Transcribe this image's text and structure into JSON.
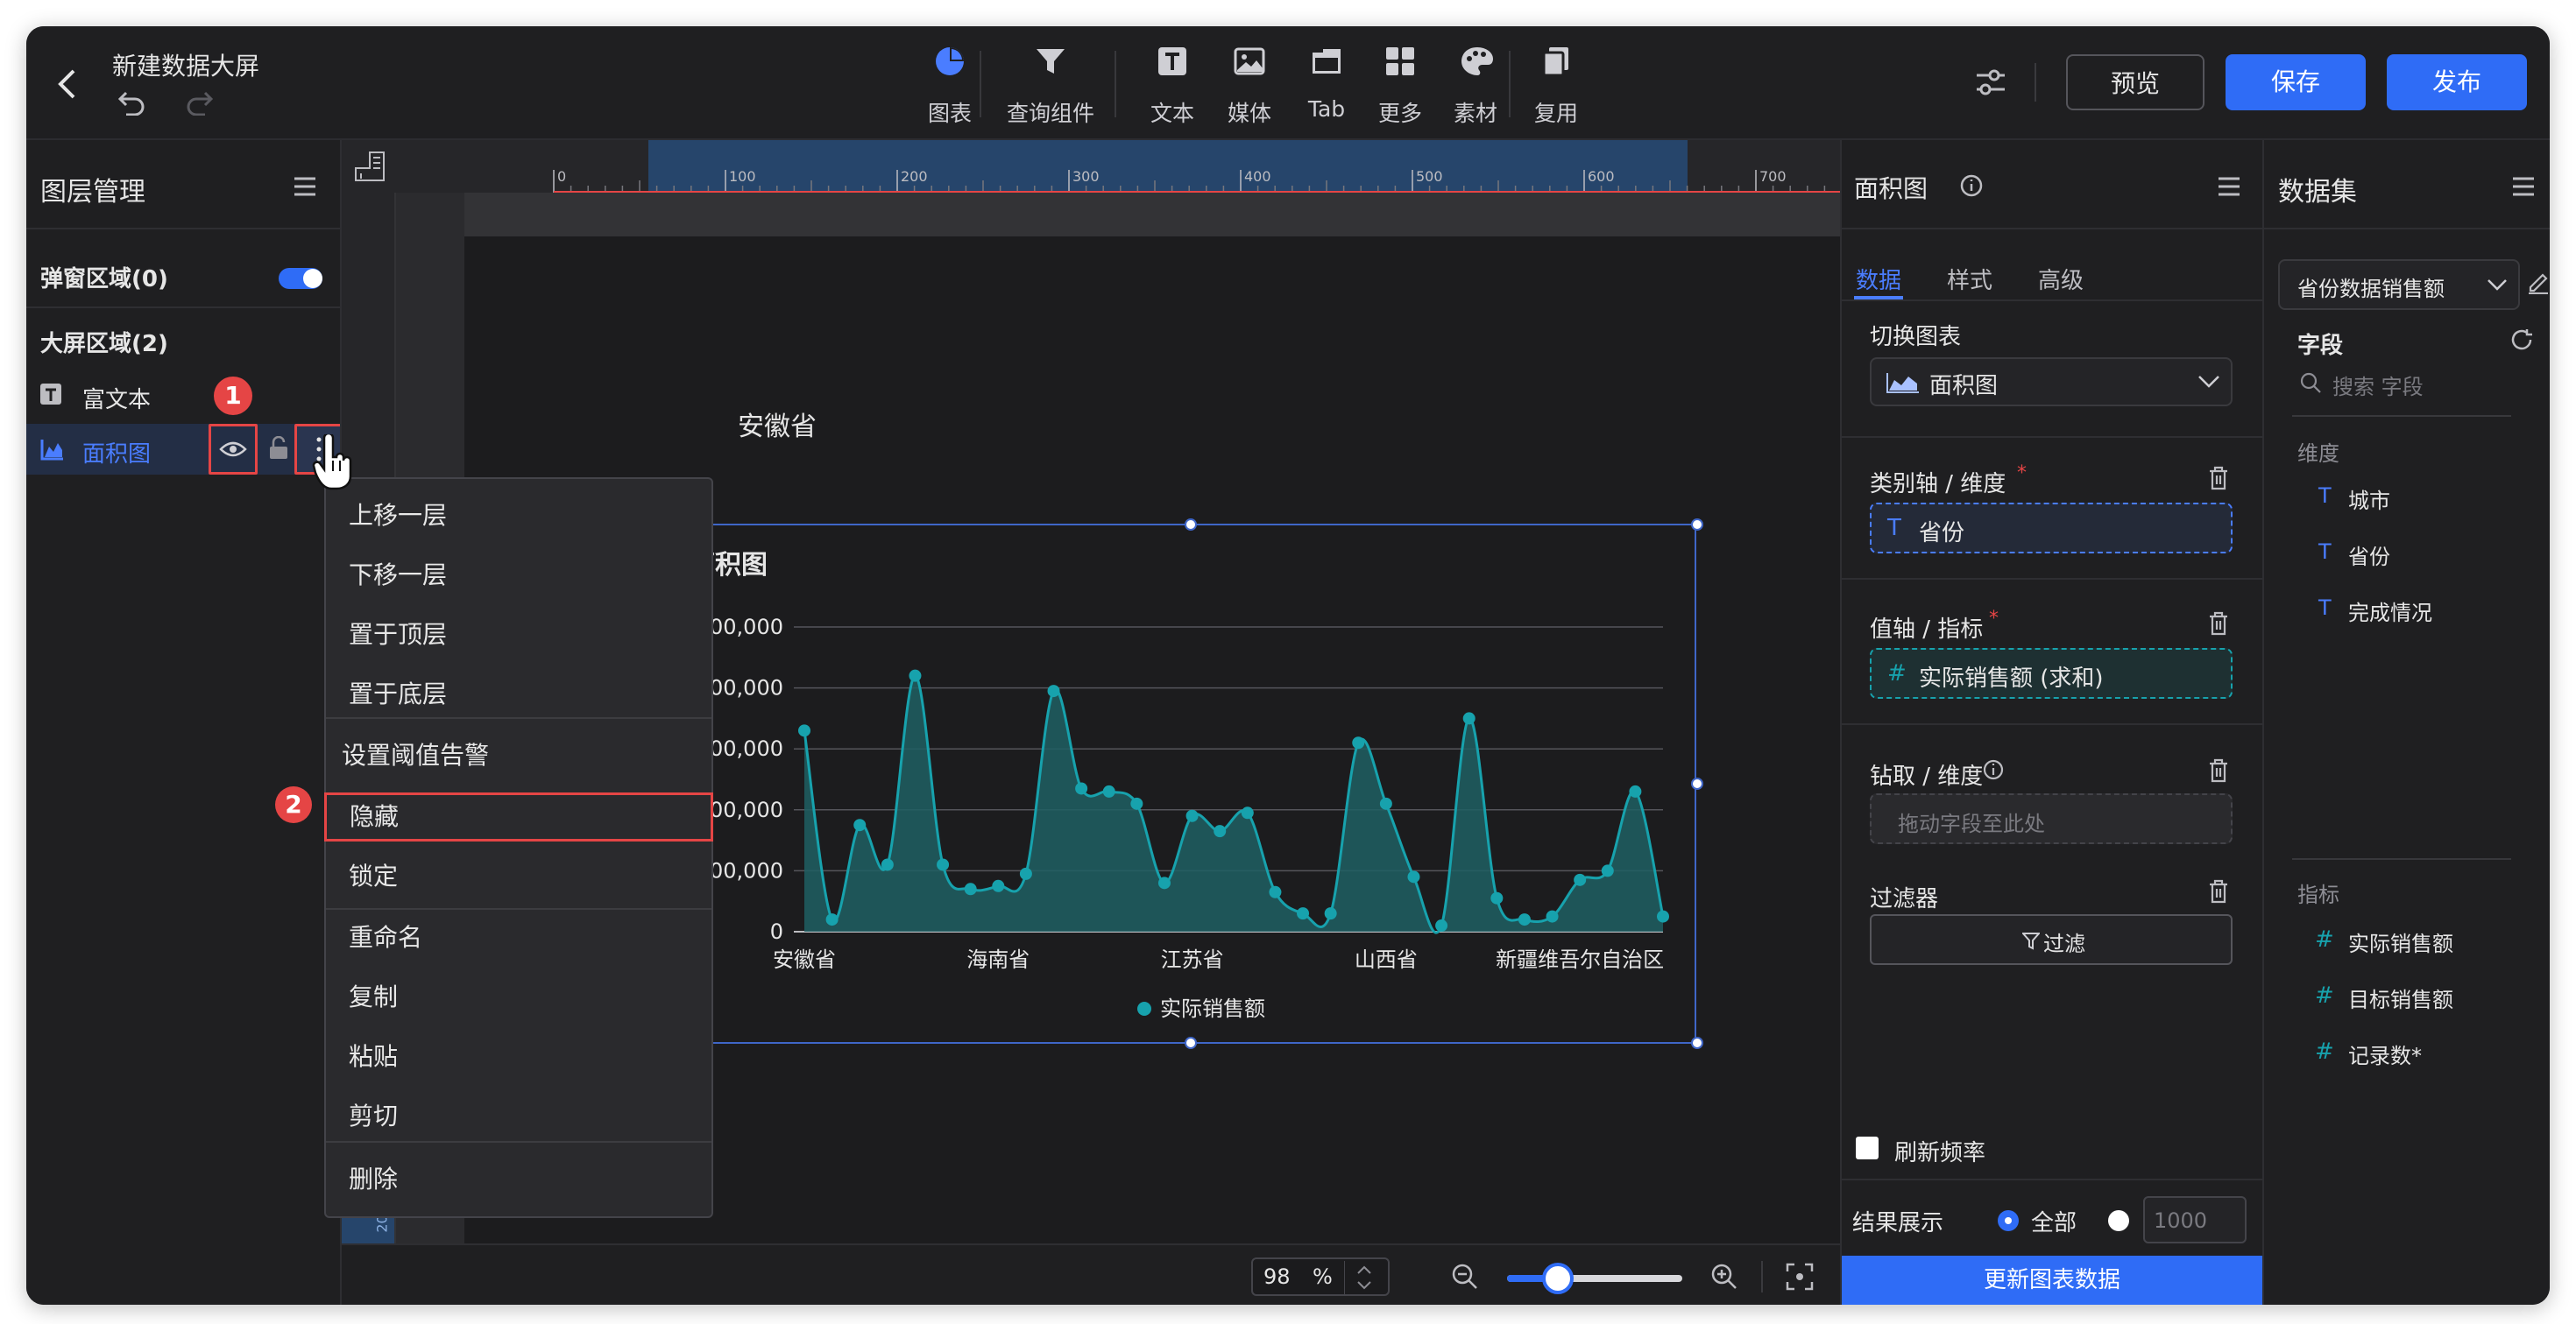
{
  "header": {
    "title": "新建数据大屏",
    "tools": [
      {
        "label": "图表"
      },
      {
        "label": "查询组件"
      },
      {
        "label": "文本"
      },
      {
        "label": "媒体"
      },
      {
        "label": "Tab"
      },
      {
        "label": "更多"
      },
      {
        "label": "素材"
      },
      {
        "label": "复用"
      }
    ],
    "preview": "预览",
    "save": "保存",
    "publish": "发布"
  },
  "layers": {
    "title": "图层管理",
    "popup_area": "弹窗区域(0)",
    "screen_area": "大屏区域(2)",
    "items": [
      {
        "label": "富文本"
      },
      {
        "label": "面积图"
      }
    ],
    "badge1": "1",
    "badge2": "2"
  },
  "context_menu": [
    "上移一层",
    "下移一层",
    "置于顶层",
    "置于底层",
    "设置阈值告警",
    "隐藏",
    "锁定",
    "重命名",
    "复制",
    "粘贴",
    "剪切",
    "删除"
  ],
  "ruler": {
    "ticks": [
      "0",
      "100",
      "200",
      "300",
      "400",
      "500",
      "600",
      "700"
    ],
    "vtick": "20"
  },
  "canvas": {
    "text_label": "安徽省",
    "chart_title": "面积图",
    "zoom": "98",
    "zoom_unit": "%"
  },
  "chart_data": {
    "type": "area",
    "title": "面积图",
    "series": [
      {
        "name": "实际销售额",
        "values": [
          33000000,
          2000000,
          17500000,
          11000000,
          42000000,
          11000000,
          7000000,
          7500000,
          9500000,
          39500000,
          23500000,
          23000000,
          21000000,
          8000000,
          19000000,
          16500000,
          19500000,
          6500000,
          3000000,
          3000000,
          31000000,
          21000000,
          9000000,
          1000000,
          35000000,
          5500000,
          2000000,
          2500000,
          8500000,
          10000000,
          23000000,
          2500000
        ]
      }
    ],
    "x_tick_labels": [
      "安徽省",
      "海南省",
      "江苏省",
      "山西省",
      "新疆维吾尔自治区"
    ],
    "x_tick_index": [
      0,
      7,
      14,
      21,
      28
    ],
    "y_ticks": [
      "0",
      "10,000,000",
      "20,000,000",
      "30,000,000",
      "40,000,000",
      "50,000,000"
    ],
    "ylim": [
      0,
      50000000
    ],
    "legend": "实际销售额",
    "legend_position": "bottom",
    "color": "#17a2ad",
    "grid": true
  },
  "props": {
    "title": "面积图",
    "tabs": [
      "数据",
      "样式",
      "高级"
    ],
    "switch_chart": "切换图表",
    "chart_type": "面积图",
    "category_axis": "类别轴 / 维度",
    "category_field": "省份",
    "value_axis": "值轴 / 指标",
    "value_field": "实际销售额 (求和)",
    "drill": "钻取 / 维度",
    "drill_placeholder": "拖动字段至此处",
    "filter": "过滤器",
    "filter_btn": "过滤",
    "refresh": "刷新频率",
    "result": "结果展示",
    "all": "全部",
    "limit": "1000",
    "update_btn": "更新图表数据"
  },
  "dataset": {
    "title": "数据集",
    "selected": "省份数据销售额",
    "fields": "字段",
    "search_placeholder": "搜索 字段",
    "dimension": "维度",
    "dims": [
      "城市",
      "省份",
      "完成情况"
    ],
    "measure": "指标",
    "measures": [
      "实际销售额",
      "目标销售额",
      "记录数*"
    ]
  },
  "colors": {
    "accent": "#2f6cf6",
    "teal": "#17a2ad",
    "red": "#e54545"
  }
}
